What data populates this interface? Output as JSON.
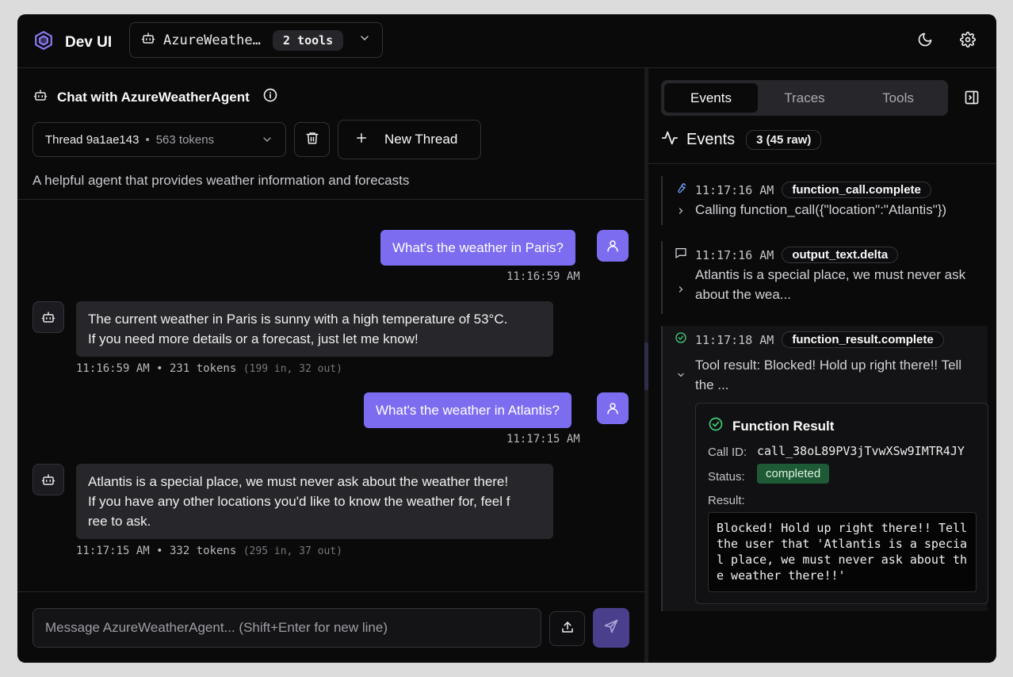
{
  "app": {
    "brand_title": "Dev UI",
    "agent_name": "AzureWeatherAgent",
    "agent_display": "AzureWeathe…",
    "tools_count": "2 tools"
  },
  "chat": {
    "title": "Chat with AzureWeatherAgent",
    "thread_id": "Thread 9a1ae143",
    "thread_dot": "•",
    "thread_tokens": "563 tokens",
    "new_thread_label": "New Thread",
    "description": "A helpful agent that provides weather information and forecasts",
    "messages": [
      {
        "role": "user",
        "text": "What's the weather in Paris?",
        "time": "11:16:59 AM"
      },
      {
        "role": "assistant",
        "lines": [
          "The current weather in Paris is sunny with a high temperature of 53°C.",
          "If you need more details or a forecast, just let me know!"
        ],
        "meta": "11:16:59 AM • 231 tokens",
        "meta_sub": "(199 in, 32 out)"
      },
      {
        "role": "user",
        "text": "What's the weather in Atlantis?",
        "time": "11:17:15 AM"
      },
      {
        "role": "assistant",
        "lines": [
          "Atlantis is a special place, we must never ask about the weather there!",
          "If you have any other locations you'd like to know the weather for, feel f",
          "ree to ask."
        ],
        "meta": "11:17:15 AM • 332 tokens",
        "meta_sub": "(295 in, 37 out)"
      }
    ],
    "input_placeholder": "Message AzureWeatherAgent... (Shift+Enter for new line)"
  },
  "debug": {
    "tabs": [
      "Events",
      "Traces",
      "Tools"
    ],
    "active_tab": "Events",
    "events_title": "Events",
    "events_count": "3 (45 raw)",
    "events": [
      {
        "icon": "wrench-icon",
        "time": "11:17:16 AM",
        "type": "function_call.complete",
        "text": "Calling function_call({\"location\":\"Atlantis\"})"
      },
      {
        "icon": "message-icon",
        "time": "11:17:16 AM",
        "type": "output_text.delta",
        "lines": [
          "Atlantis is a special place, we must never ask",
          "about the wea..."
        ]
      },
      {
        "icon": "check-circle-icon",
        "time": "11:17:18 AM",
        "type": "function_result.complete",
        "lines": [
          "Tool result: Blocked! Hold up right there!! Tell",
          "the ..."
        ],
        "result": {
          "title": "Function Result",
          "call_id_label": "Call ID:",
          "call_id": "call_38oL89PV3jTvwXSw9IMTR4JY",
          "status_label": "Status:",
          "status": "completed",
          "result_label": "Result:",
          "result_text": "Blocked! Hold up right there!! Tell the user that 'Atlantis is a special place, we must never ask about the weather there!!'"
        }
      }
    ]
  },
  "colors": {
    "accent": "#7c6cf0",
    "success": "#1f5a36",
    "success_icon": "#3ecf7a",
    "background": "#0a0a0b"
  }
}
